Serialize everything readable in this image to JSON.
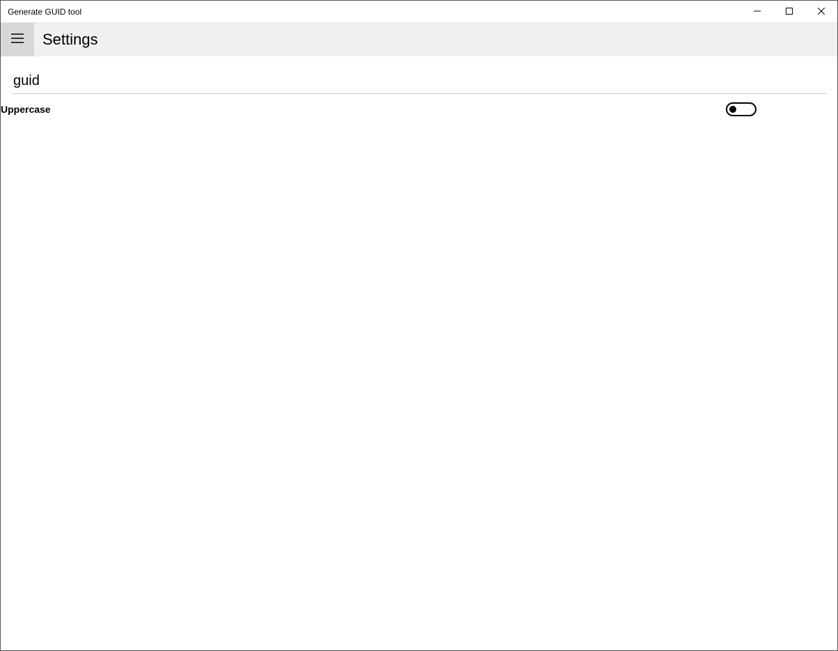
{
  "window": {
    "title": "Generate GUID tool"
  },
  "header": {
    "page_title": "Settings"
  },
  "search": {
    "value": "guid",
    "placeholder": ""
  },
  "settings": {
    "uppercase": {
      "label": "Uppercase",
      "value": false
    }
  }
}
